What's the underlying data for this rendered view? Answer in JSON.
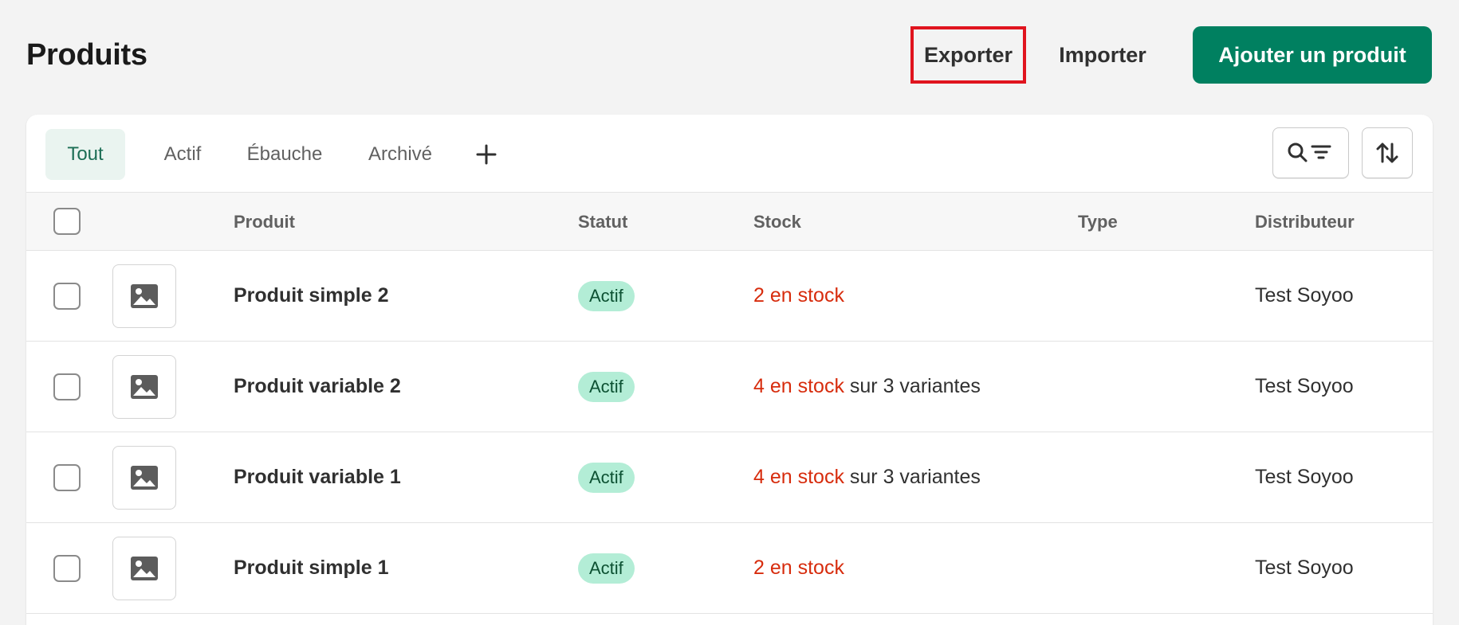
{
  "header": {
    "title": "Produits",
    "export_label": "Exporter",
    "import_label": "Importer",
    "add_label": "Ajouter un produit"
  },
  "tabs": [
    {
      "label": "Tout",
      "active": true
    },
    {
      "label": "Actif",
      "active": false
    },
    {
      "label": "Ébauche",
      "active": false
    },
    {
      "label": "Archivé",
      "active": false
    }
  ],
  "columns": {
    "product": "Produit",
    "status": "Statut",
    "stock": "Stock",
    "type": "Type",
    "vendor": "Distributeur"
  },
  "rows": [
    {
      "name": "Produit simple 2",
      "status": "Actif",
      "stock_red": "2 en stock",
      "stock_rest": "",
      "type": "",
      "vendor": "Test Soyoo"
    },
    {
      "name": "Produit variable 2",
      "status": "Actif",
      "stock_red": "4 en stock",
      "stock_rest": " sur 3 variantes",
      "type": "",
      "vendor": "Test Soyoo"
    },
    {
      "name": "Produit variable 1",
      "status": "Actif",
      "stock_red": "4 en stock",
      "stock_rest": " sur 3 variantes",
      "type": "",
      "vendor": "Test Soyoo"
    },
    {
      "name": "Produit simple 1",
      "status": "Actif",
      "stock_red": "2 en stock",
      "stock_rest": "",
      "type": "",
      "vendor": "Test Soyoo"
    }
  ],
  "icons": {
    "add_tab": "plus-icon",
    "search_filter": "search-filter-icon",
    "sort": "sort-icon",
    "thumbnail": "image-placeholder-icon"
  },
  "colors": {
    "primary": "#008060",
    "highlight": "#e0141e",
    "stock_alert": "#d72c0d",
    "badge_bg": "#b3edd6",
    "active_tab_bg": "#eaf4f0"
  }
}
